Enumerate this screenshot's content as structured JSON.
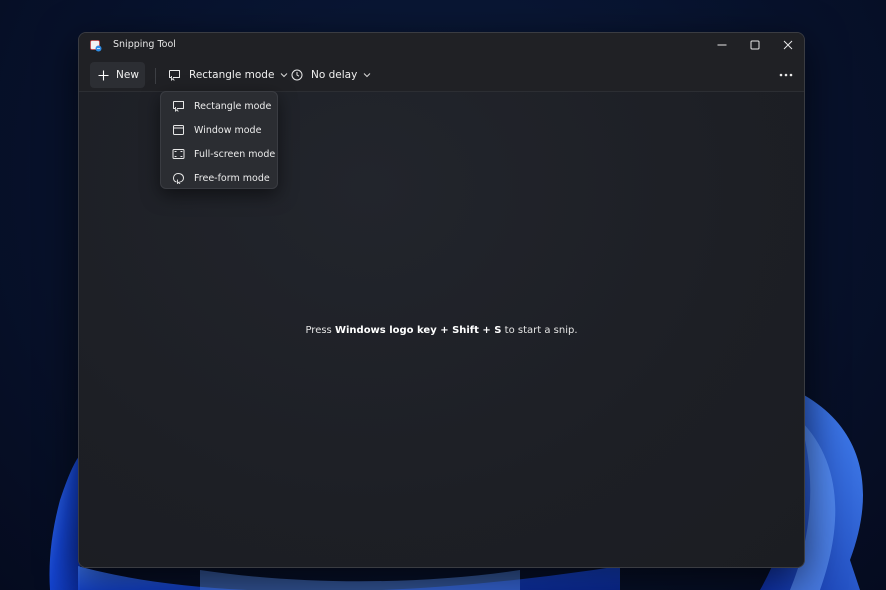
{
  "window": {
    "title": "Snipping Tool",
    "app_icon": "snipping-tool-icon"
  },
  "caption_buttons": {
    "minimize_icon": "minimize-icon",
    "maximize_icon": "maximize-icon",
    "close_icon": "close-icon"
  },
  "toolbar": {
    "new_label": "New",
    "new_icon": "plus-icon",
    "mode_label": "Rectangle mode",
    "mode_icon": "rectangle-mode-icon",
    "delay_label": "No delay",
    "delay_icon": "clock-icon",
    "more_icon": "more-icon"
  },
  "mode_menu": {
    "items": [
      {
        "label": "Rectangle mode",
        "icon": "rectangle-mode-icon"
      },
      {
        "label": "Window mode",
        "icon": "window-mode-icon"
      },
      {
        "label": "Full-screen mode",
        "icon": "full-screen-mode-icon"
      },
      {
        "label": "Free-form mode",
        "icon": "free-form-mode-icon"
      }
    ]
  },
  "content": {
    "hint_prefix": "Press ",
    "hint_keys": "Windows logo key + Shift + S",
    "hint_suffix": " to start a snip."
  },
  "colors": {
    "window_bg": "#202227",
    "menu_bg": "#2b2d32",
    "text": "#f0f0f0",
    "wallpaper_accent": "#1f4fd8"
  }
}
